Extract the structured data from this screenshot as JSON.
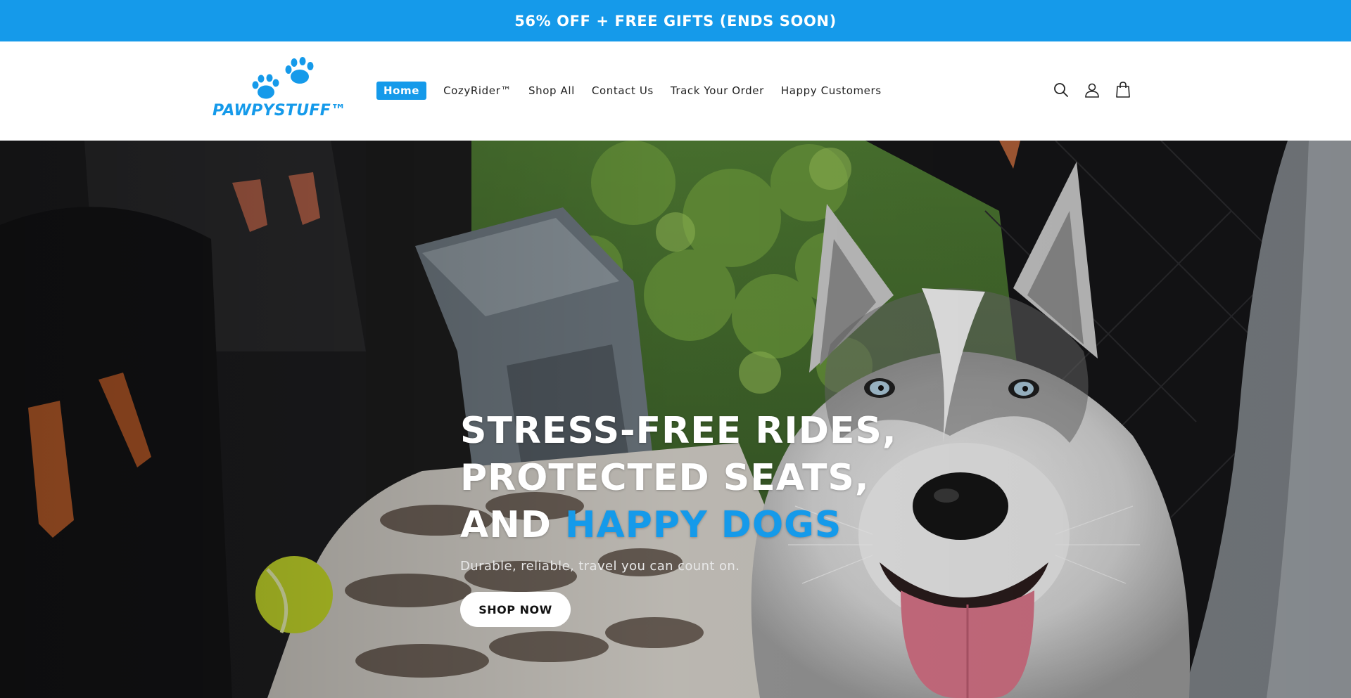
{
  "announcement": {
    "text": "56% OFF + FREE GIFTS (ENDS SOON)"
  },
  "brand": {
    "name": "PAWPYSTUFF™",
    "color": "#159aea"
  },
  "nav": {
    "items": [
      {
        "label": "Home",
        "active": true
      },
      {
        "label": "CozyRider™"
      },
      {
        "label": "Shop All"
      },
      {
        "label": "Contact Us"
      },
      {
        "label": "Track Your Order"
      },
      {
        "label": "Happy Customers"
      }
    ]
  },
  "header_icons": [
    "search-icon",
    "account-icon",
    "cart-icon"
  ],
  "hero": {
    "headline_line1": "STRESS-FREE RIDES,",
    "headline_line2": "PROTECTED SEATS,",
    "headline_line3_prefix": "AND ",
    "headline_line3_accent": "HAPPY DOGS",
    "subtext": "Durable, reliable, travel you can count on.",
    "cta_label": "SHOP NOW"
  },
  "colors": {
    "accent": "#159aea",
    "announcement_bg": "#159aea"
  }
}
